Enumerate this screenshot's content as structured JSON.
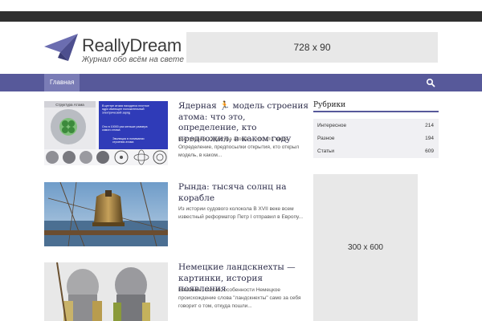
{
  "header": {
    "logo_title": "ReallyDream",
    "logo_tagline": "Журнал обо всём на свете",
    "ad_banner": "728 x 90"
  },
  "nav": {
    "items": [
      {
        "label": "Главная"
      }
    ],
    "search_icon": "search-icon"
  },
  "posts": [
    {
      "title_before": "Ядерная ",
      "title_after": " модель строения атома: что это, определение, кто предложил, в каком году",
      "title_emoji": "🏃",
      "excerpt": "Внутренняя структура атома — что это такое Определение, предпосылки открытия, кто открыл модель, в каком..."
    },
    {
      "title": "Рында: тысяча солнц на корабле",
      "excerpt": "Из истории судового колокола В XVII веке всем известный реформатор Петр I отправил в Европу..."
    },
    {
      "title": "Немецкие ландскнехты — картинки, история появления",
      "excerpt": "Название, состав, особенности Немецкое происхождение слова \"ландскнехты\" само за себя говорит о том, откуда пошли..."
    }
  ],
  "sidebar": {
    "heading": "Рубрики",
    "categories": [
      {
        "name": "Интересное",
        "count": "214"
      },
      {
        "name": "Разное",
        "count": "194"
      },
      {
        "name": "Статьи",
        "count": "609"
      }
    ],
    "ad_banner": "300 x 600"
  },
  "thumb1_text": {
    "panel_title": "Структура Атома",
    "blue_text": "В центре атома находится плотное ядро имеющее положительный электрический заряд",
    "blue_text2": "Оно в 10000 раз меньше размера самого атома",
    "evolution": "Эволюция в понимании строения атома"
  },
  "colors": {
    "nav": "#57599a",
    "nav_active": "#7a7cb6",
    "accent": "#57599a"
  }
}
